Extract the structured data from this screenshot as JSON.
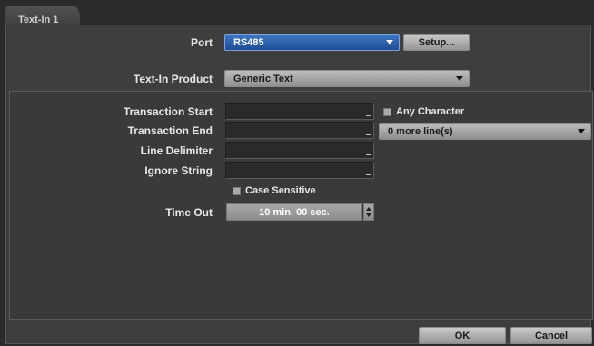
{
  "tab": {
    "title": "Text-In 1"
  },
  "port": {
    "label": "Port",
    "value": "RS485",
    "setup_label": "Setup..."
  },
  "product": {
    "label": "Text-In Product",
    "value": "Generic Text"
  },
  "transaction_start": {
    "label": "Transaction Start",
    "value": ""
  },
  "any_character": {
    "label": "Any Character",
    "checked": false
  },
  "transaction_end": {
    "label": "Transaction End",
    "value": "",
    "more_lines_value": "0 more line(s)"
  },
  "line_delimiter": {
    "label": "Line Delimiter",
    "value": ""
  },
  "ignore_string": {
    "label": "Ignore String",
    "value": ""
  },
  "case_sensitive": {
    "label": "Case Sensitive",
    "checked": false
  },
  "time_out": {
    "label": "Time Out",
    "value": "10 min. 00 sec."
  },
  "footer": {
    "ok_label": "OK",
    "cancel_label": "Cancel"
  },
  "colors": {
    "accent": "#2a5fae",
    "panel": "#3e3e3e",
    "background": "#2b2b2b"
  }
}
